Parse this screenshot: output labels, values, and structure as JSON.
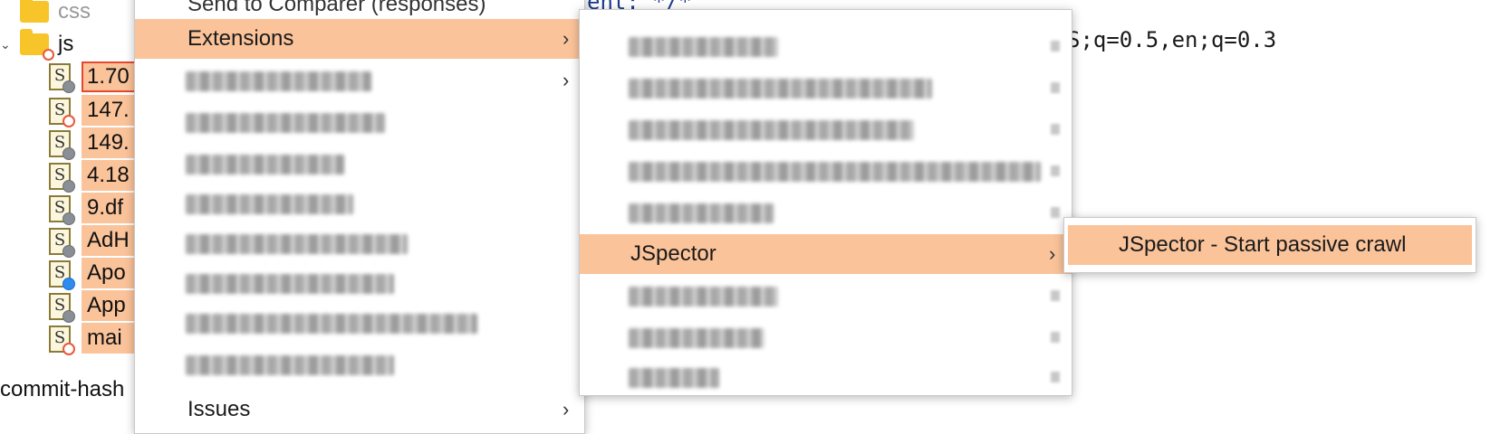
{
  "tree": {
    "folders": [
      {
        "label": "css"
      },
      {
        "label": "js"
      }
    ],
    "files": [
      {
        "label": "1.70",
        "badge": "grey"
      },
      {
        "label": "147.",
        "badge": "red"
      },
      {
        "label": "149.",
        "badge": "grey"
      },
      {
        "label": "4.18",
        "badge": "grey"
      },
      {
        "label": "9.df",
        "badge": "grey"
      },
      {
        "label": "AdH",
        "badge": "grey"
      },
      {
        "label": "Apo",
        "badge": "blue"
      },
      {
        "label": "App",
        "badge": "grey"
      },
      {
        "label": "mai",
        "badge": "red"
      }
    ],
    "file_icon_glyph": "S",
    "bottom_label": "commit-hash"
  },
  "editor": {
    "top_text": "ent: */*",
    "accept_language_fragment": "S;q=0.5,en;q=0.3"
  },
  "menu1": {
    "top_item_partial": "Send to Comparer (responses)",
    "extensions_label": "Extensions",
    "bottom_item_partial": "Issues",
    "arrow": "›"
  },
  "menu2": {
    "jspector_label": "JSpector",
    "arrow": "›"
  },
  "menu3": {
    "start_passive_crawl_label": "JSpector - Start passive crawl"
  },
  "colors": {
    "highlight": "#fbc39a",
    "focus_border": "#e5482f",
    "folder": "#f7c52a"
  }
}
